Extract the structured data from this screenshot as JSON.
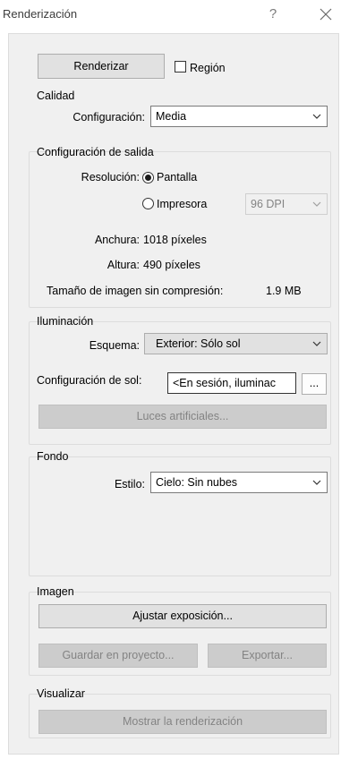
{
  "window": {
    "title": "Renderización",
    "help_label": "?"
  },
  "top": {
    "render_button": "Renderizar",
    "region_label": "Región",
    "region_checked": false
  },
  "quality": {
    "group_title": "Calidad",
    "config_label": "Configuración:",
    "config_value": "Media"
  },
  "output": {
    "group_title": "Configuración de salida",
    "resolution_label": "Resolución:",
    "option_screen": "Pantalla",
    "option_printer": "Impresora",
    "selected": "Pantalla",
    "dpi_value": "96 DPI",
    "width_label": "Anchura:",
    "width_value": "1018 píxeles",
    "height_label": "Altura:",
    "height_value": "490 píxeles",
    "size_label": "Tamaño de imagen sin compresión:",
    "size_value": "1.9 MB"
  },
  "lighting": {
    "group_title": "Iluminación",
    "scheme_label": "Esquema:",
    "scheme_value": "Exterior: Sólo sol",
    "sun_label": "Configuración de sol:",
    "sun_value": "<En sesión, iluminac",
    "ellipsis_label": "...",
    "artificial_button": "Luces artificiales..."
  },
  "background": {
    "group_title": "Fondo",
    "style_label": "Estilo:",
    "style_value": "Cielo: Sin nubes"
  },
  "image": {
    "group_title": "Imagen",
    "adjust_button": "Ajustar exposición...",
    "save_button": "Guardar en proyecto...",
    "export_button": "Exportar..."
  },
  "display": {
    "group_title": "Visualizar",
    "show_button": "Mostrar la renderización"
  }
}
